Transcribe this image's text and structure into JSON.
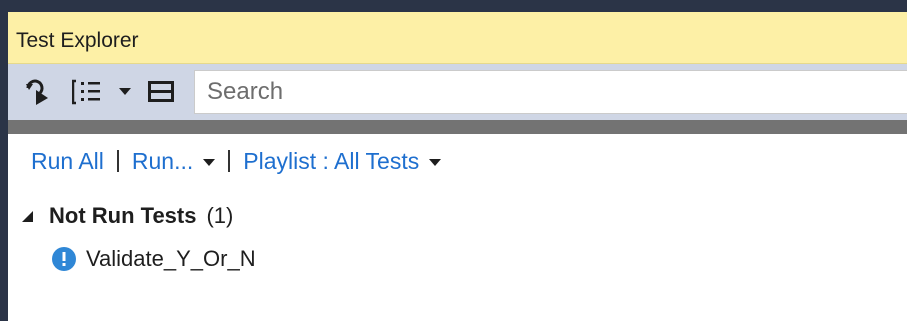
{
  "window": {
    "title": "Test Explorer"
  },
  "toolbar": {
    "run_icon": "run-icon",
    "group_by_icon": "group-by-icon",
    "group_by_dropdown_icon": "chevron-down-icon",
    "columns_icon": "columns-icon",
    "search": {
      "placeholder": "Search",
      "value": ""
    }
  },
  "actions": {
    "run_all_label": "Run All",
    "run_label": "Run...",
    "playlist_label": "Playlist : All Tests"
  },
  "tests": {
    "group": {
      "name": "Not Run Tests",
      "count": "(1)",
      "expanded": true
    },
    "items": [
      {
        "name": "Validate_Y_Or_N",
        "status_icon": "not-run-icon"
      }
    ]
  },
  "colors": {
    "title_bar": "#fdf0a6",
    "toolbar": "#cfd6e5",
    "link": "#1e6fcf",
    "status_icon": "#2f87d6",
    "frame": "#2b3447"
  }
}
